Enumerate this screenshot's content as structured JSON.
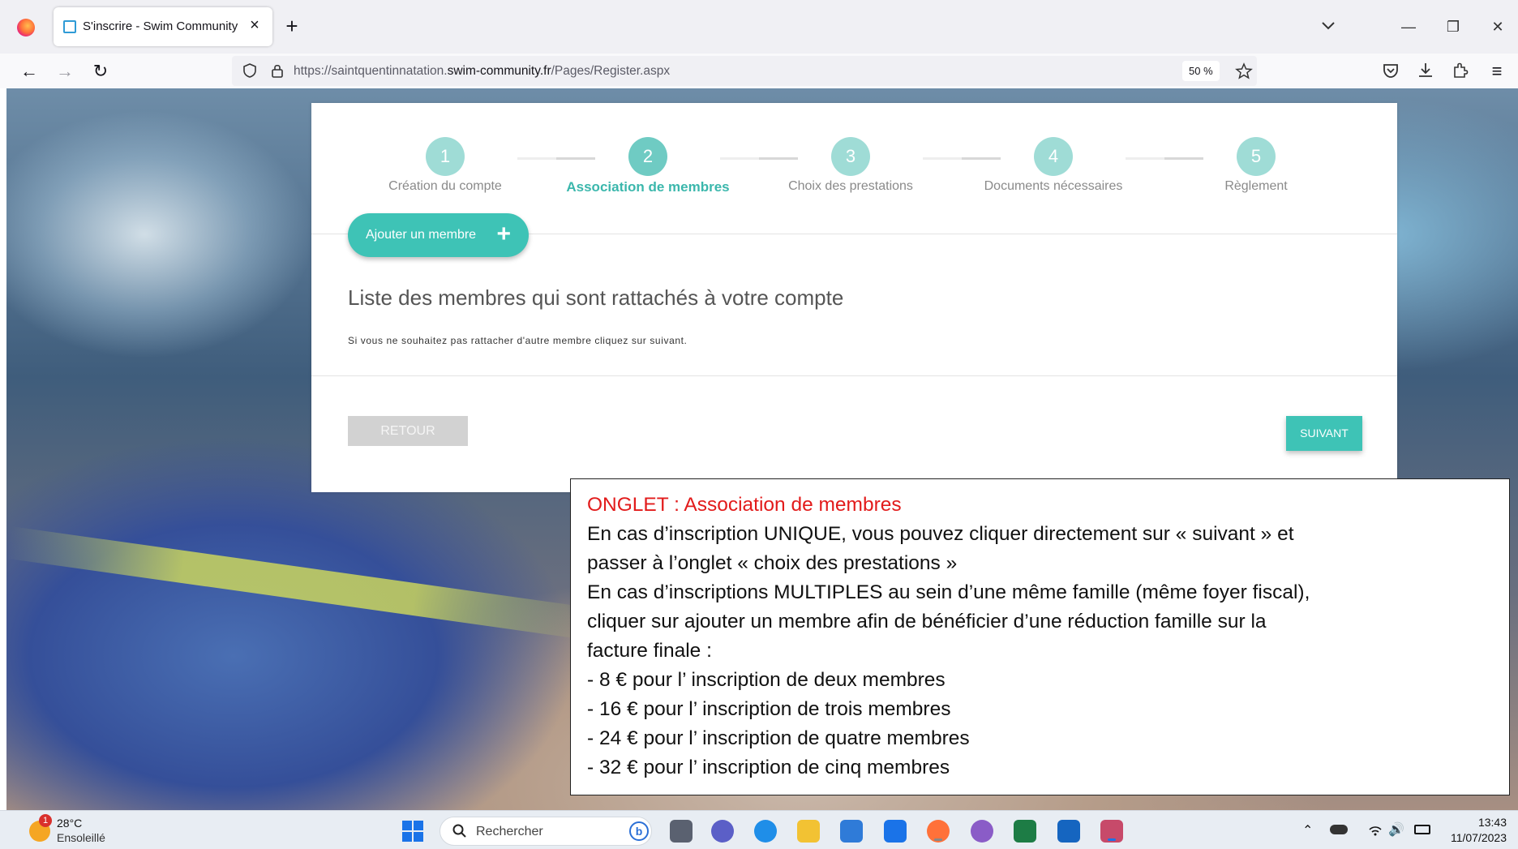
{
  "browser": {
    "tab_title": "S'inscrire - Swim Community",
    "url_prefix": "https://saintquentinnatation.",
    "url_domain": "swim-community.fr",
    "url_path": "/Pages/Register.aspx",
    "zoom": "50 %"
  },
  "stepper": {
    "active_step": 2,
    "steps": [
      {
        "number": "1",
        "label": "Création du compte"
      },
      {
        "number": "2",
        "label": "Association de membres"
      },
      {
        "number": "3",
        "label": "Choix des prestations"
      },
      {
        "number": "4",
        "label": "Documents nécessaires"
      },
      {
        "number": "5",
        "label": "Règlement"
      }
    ]
  },
  "card": {
    "add_member_label": "Ajouter un membre",
    "list_title": "Liste des membres qui sont rattachés à votre compte",
    "list_hint": "Si vous ne souhaitez pas rattacher d'autre membre cliquez sur suivant.",
    "back_label": "RETOUR",
    "next_label": "SUIVANT"
  },
  "note": {
    "title": "ONGLET : Association de membres",
    "lines": [
      "En cas d’inscription UNIQUE, vous pouvez cliquer directement sur « suivant » et",
      "passer à l’onglet « choix des prestations »",
      "En cas d’inscriptions MULTIPLES au sein d’une même famille (même foyer fiscal),",
      "cliquer sur ajouter un membre afin de bénéficier d’une réduction famille sur la",
      "facture finale :",
      "- 8 € pour l’ inscription de deux membres",
      "- 16 € pour l’ inscription de trois membres",
      "- 24 € pour l’ inscription de quatre membres",
      "- 32 € pour l’ inscription de cinq membres"
    ]
  },
  "taskbar": {
    "weather_badge": "1",
    "weather_temp": "28°C",
    "weather_desc": "Ensoleillé",
    "search_placeholder": "Rechercher",
    "clock_time": "13:43",
    "clock_date": "11/07/2023"
  },
  "colors": {
    "accent": "#3ec3b6",
    "note_title": "#e21b1b"
  }
}
